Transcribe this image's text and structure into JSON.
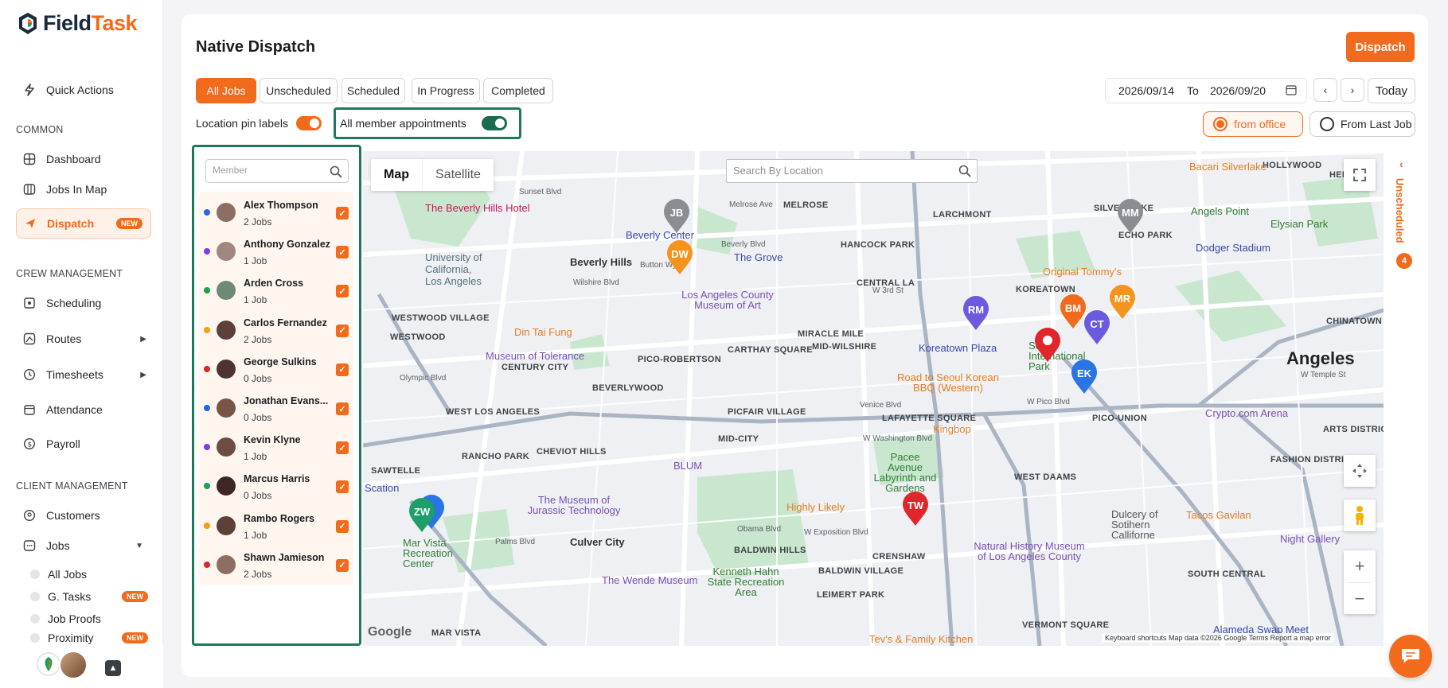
{
  "app": {
    "name_part1": "Field",
    "name_part2": "Task"
  },
  "sidebar": {
    "quick_actions": "Quick Actions",
    "section_common": "COMMON",
    "dashboard": "Dashboard",
    "jobs_in_map": "Jobs In Map",
    "dispatch": "Dispatch",
    "dispatch_badge": "NEW",
    "section_crew": "CREW MANAGEMENT",
    "scheduling": "Scheduling",
    "routes": "Routes",
    "timesheets": "Timesheets",
    "attendance": "Attendance",
    "payroll": "Payroll",
    "section_client": "CLIENT MANAGEMENT",
    "customers": "Customers",
    "jobs": "Jobs",
    "jobs_sub": [
      {
        "label": "All Jobs",
        "badge": ""
      },
      {
        "label": "G. Tasks",
        "badge": "NEW"
      },
      {
        "label": "Job Proofs",
        "badge": ""
      },
      {
        "label": "Proximity",
        "badge": "NEW"
      }
    ]
  },
  "header": {
    "title": "Native Dispatch",
    "dispatch_button": "Dispatch",
    "tabs": [
      "All Jobs",
      "Unscheduled",
      "Scheduled",
      "In Progress",
      "Completed"
    ],
    "active_tab": "All Jobs",
    "date_from": "2026/09/14",
    "date_to_label": "To",
    "date_to": "2026/09/20",
    "today": "Today",
    "location_pin_labels": "Location pin labels",
    "all_member_appointments": "All member appointments",
    "from_office": "from office",
    "from_last_job": "From Last Job"
  },
  "members": {
    "search_placeholder": "Member",
    "list": [
      {
        "name": "Alex Thompson",
        "jobs": "2 Jobs",
        "color": "#2563eb"
      },
      {
        "name": "Anthony Gonzalez",
        "jobs": "1 Job",
        "color": "#7c3aed"
      },
      {
        "name": "Arden Cross",
        "jobs": "1 Job",
        "color": "#16a34a"
      },
      {
        "name": "Carlos Fernandez",
        "jobs": "2 Jobs",
        "color": "#f59e0b"
      },
      {
        "name": "George Sulkins",
        "jobs": "0 Jobs",
        "color": "#dc2626"
      },
      {
        "name": "Jonathan Evans...",
        "jobs": "0 Jobs",
        "color": "#2563eb"
      },
      {
        "name": "Kevin Klyne",
        "jobs": "1 Job",
        "color": "#7c3aed"
      },
      {
        "name": "Marcus Harris",
        "jobs": "0 Jobs",
        "color": "#16a34a"
      },
      {
        "name": "Rambo Rogers",
        "jobs": "1 Job",
        "color": "#f59e0b"
      },
      {
        "name": "Shawn Jamieson",
        "jobs": "2 Jobs",
        "color": "#dc2626"
      }
    ]
  },
  "map": {
    "type_map": "Map",
    "type_satellite": "Satellite",
    "search_placeholder": "Search By Location",
    "google": "Google",
    "attribution": "Keyboard shortcuts     Map data ©2026 Google     Terms     Report a map error",
    "pins": [
      {
        "initials": "JB",
        "color": "#8a8d91"
      },
      {
        "initials": "DW",
        "color": "#f5931f"
      },
      {
        "initials": "MM",
        "color": "#8a8d91"
      },
      {
        "initials": "RM",
        "color": "#6a5ae0"
      },
      {
        "initials": "CT",
        "color": "#6a5ae0"
      },
      {
        "initials": "MR",
        "color": "#f5931f"
      },
      {
        "initials": "EK",
        "color": "#2a74e6"
      },
      {
        "initials": "TW",
        "color": "#e0262b"
      },
      {
        "initials": "ZW",
        "color": "#1e9e6a"
      }
    ],
    "areas": [
      "HOLLYWOOD",
      "MELROSE",
      "LARCHMONT",
      "SILVER LAKE",
      "ECHO PARK",
      "HANCOCK PARK",
      "CENTRAL LA",
      "KOREATOWN",
      "MIRACLE MILE",
      "MID-WILSHIRE",
      "CARTHAY SQUARE",
      "PICO-ROBERTSON",
      "CENTURY CITY",
      "BEVERLYWOOD",
      "WESTWOOD VILLAGE",
      "WESTWOOD",
      "WEST LOS ANGELES",
      "PICFAIR VILLAGE",
      "MID-CITY",
      "LAFAYETTE SQUARE",
      "PICO-UNION",
      "RANCHO PARK",
      "CHEVIOT HILLS",
      "SAWTELLE",
      "WEST DAAMS",
      "FASHION DISTRICT",
      "ARTS DISTRICT",
      "CHINATOWN",
      "SOUTH CENTRAL",
      "BALDWIN HILLS",
      "CRENSHAW",
      "BALDWIN VILLAGE",
      "LEIMERT PARK",
      "VERMONT SQUARE",
      "MAR VISTA",
      "HEIGHTS"
    ],
    "places": [
      "Beverly Hills",
      "Culver City",
      "Angeles",
      "The Beverly Hills Hotel",
      "University of California, Los Angeles",
      "Beverly Center",
      "The Grove",
      "Los Angeles County Museum of Art",
      "Din Tai Fung",
      "Museum of Tolerance",
      "Original Tommy's",
      "Angels Point",
      "Elysian Park",
      "Dodger Stadium",
      "Bacari Silverlake",
      "Koreatown Plaza",
      "Seoul International Park",
      "Road to Seoul Korean BBQ (Western)",
      "Kingbop",
      "Crypto.com Arena",
      "BLUM",
      "Pacee Avenue Labyrinth and Gardens",
      "Highly Likely",
      "The Museum of Jurassic Technology",
      "Mar Vista Recreation Center",
      "Kenneth Hahn State Recreation Area",
      "The Wende Museum",
      "Natural History Museum of Los Angeles County",
      "Tacos Gavilan",
      "Night Gallery",
      "Alameda Swap Meet",
      "Tev's & Family Kitchen",
      "Scation",
      "Dulcery of Sotihern Calliforne"
    ],
    "streets": [
      "Sunset Blvd",
      "Beverly Blvd",
      "Button Wy",
      "Wilshire Blvd",
      "W 3rd St",
      "Olympic Blvd",
      "W Pico Blvd",
      "Venice Blvd",
      "W Washington Blvd",
      "Obama Blvd",
      "Palms Blvd",
      "W Exposition Blvd",
      "W Temple St",
      "Melrose Ave"
    ]
  },
  "unscheduled": {
    "label": "Unscheduled",
    "count": "4"
  }
}
